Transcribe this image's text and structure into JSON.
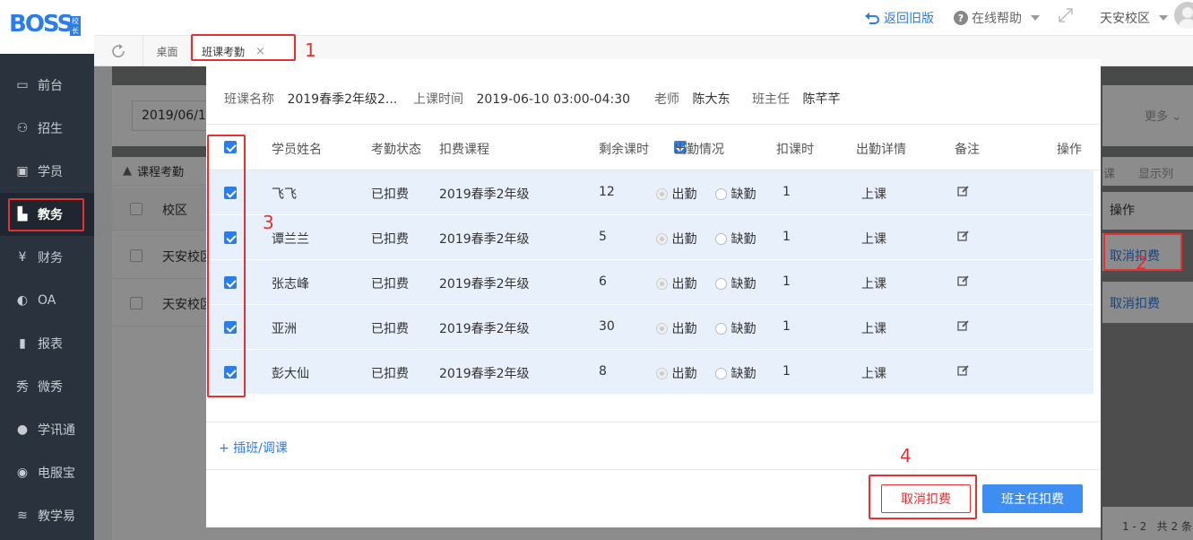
{
  "app": {
    "logo_text": "BOSS",
    "logo_sub": "校长"
  },
  "topbar": {
    "back_old": "返回旧版",
    "help": "在线帮助",
    "campus": "天安校区"
  },
  "tabs": [
    {
      "label": "桌面"
    },
    {
      "label": "班课考勤",
      "close": "×"
    }
  ],
  "sidebar": {
    "items": [
      {
        "label": "前台",
        "icon": "calendar-icon"
      },
      {
        "label": "招生",
        "icon": "user-add-icon"
      },
      {
        "label": "学员",
        "icon": "id-card-icon"
      },
      {
        "label": "教务",
        "icon": "board-icon",
        "active": true
      },
      {
        "label": "财务",
        "icon": "yen-icon"
      },
      {
        "label": "OA",
        "icon": "chat-icon"
      },
      {
        "label": "报表",
        "icon": "bar-chart-icon"
      },
      {
        "label": "微秀",
        "icon": "xiu-icon"
      },
      {
        "label": "学讯通",
        "icon": "location-icon"
      },
      {
        "label": "电服宝",
        "icon": "phone-icon"
      },
      {
        "label": "教学易",
        "icon": "book-icon"
      }
    ]
  },
  "background": {
    "date": "2019/06/10",
    "more": "更多",
    "section_title": "课程考勤",
    "col_campus": "校区",
    "col_action": "操作",
    "toolbar_right": [
      "课",
      "显示列"
    ],
    "rows": [
      {
        "campus": "天安校区",
        "action": "取消扣费"
      },
      {
        "campus": "天安校区",
        "action": "取消扣费"
      }
    ],
    "pagination": "1 - 2   共 2 条"
  },
  "modal": {
    "info": {
      "class_label": "班课名称",
      "class_value": "2019春季2年级2...",
      "time_label": "上课时间",
      "time_value": "2019-06-10 03:00-04:30",
      "teacher_label": "老师",
      "teacher_value": "陈大东",
      "head_label": "班主任",
      "head_value": "陈芊芊"
    },
    "columns": {
      "name": "学员姓名",
      "status": "考勤状态",
      "course": "扣费课程",
      "remaining": "剩余课时",
      "attendance": "出勤情况",
      "deduct": "扣课时",
      "detail": "出勤详情",
      "note": "备注",
      "action": "操作"
    },
    "rows": [
      {
        "name": "飞飞",
        "status": "已扣费",
        "course": "2019春季2年级",
        "remaining": "12",
        "present": "出勤",
        "absent": "缺勤",
        "deduct": "1",
        "detail": "上课"
      },
      {
        "name": "谭兰兰",
        "status": "已扣费",
        "course": "2019春季2年级",
        "remaining": "5",
        "present": "出勤",
        "absent": "缺勤",
        "deduct": "1",
        "detail": "上课"
      },
      {
        "name": "张志峰",
        "status": "已扣费",
        "course": "2019春季2年级",
        "remaining": "6",
        "present": "出勤",
        "absent": "缺勤",
        "deduct": "1",
        "detail": "上课"
      },
      {
        "name": "亚洲",
        "status": "已扣费",
        "course": "2019春季2年级",
        "remaining": "30",
        "present": "出勤",
        "absent": "缺勤",
        "deduct": "1",
        "detail": "上课"
      },
      {
        "name": "彭大仙",
        "status": "已扣费",
        "course": "2019春季2年级",
        "remaining": "8",
        "present": "出勤",
        "absent": "缺勤",
        "deduct": "1",
        "detail": "上课"
      }
    ],
    "add_link": "+ 插班/调课",
    "cancel_button": "取消扣费",
    "confirm_button": "班主任扣费"
  },
  "annotations": [
    "1",
    "2",
    "3",
    "4"
  ],
  "colors": {
    "accent": "#2b7de9",
    "annotation": "#e43131",
    "row_bg": "#e8f0fc",
    "sidebar": "#29323d"
  }
}
